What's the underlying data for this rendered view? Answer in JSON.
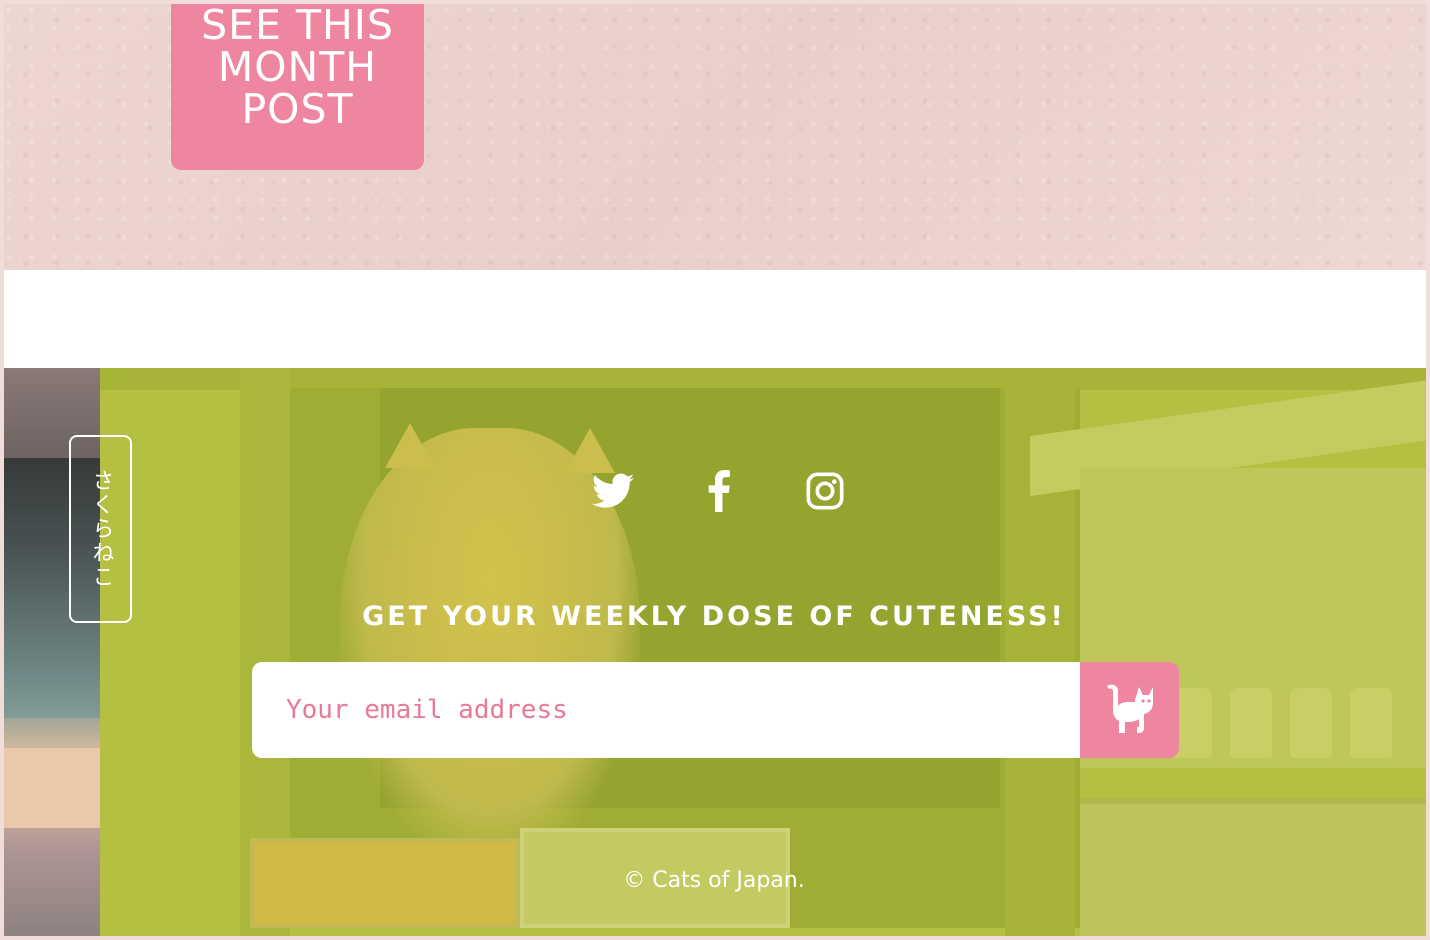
{
  "hero": {
    "cta_lines": [
      "SEE THIS",
      "MONTH",
      "POST"
    ]
  },
  "footer": {
    "vertical_label": "さくらねこ",
    "social": [
      {
        "name": "twitter",
        "icon": "twitter-bird-icon"
      },
      {
        "name": "facebook",
        "icon": "facebook-f-icon"
      },
      {
        "name": "instagram",
        "icon": "instagram-camera-icon"
      }
    ],
    "tagline": "GET YOUR WEEKLY DOSE OF CUTENESS!",
    "subscribe": {
      "placeholder": "Your email address",
      "button_icon": "cat-icon"
    },
    "copyright": "© Cats of Japan."
  },
  "colors": {
    "accent_pink": "#ee86a0",
    "overlay_green": "#b0bc30",
    "wall": "#ecd6d1"
  }
}
